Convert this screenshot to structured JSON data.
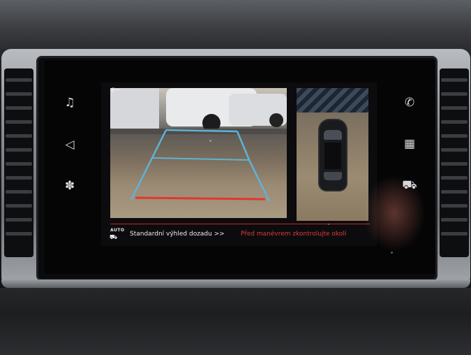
{
  "sidebar_left": {
    "items": [
      {
        "icon": "music-note-icon",
        "glyph": "♫"
      },
      {
        "icon": "navigation-icon",
        "glyph": "◁"
      },
      {
        "icon": "fan-icon",
        "glyph": "✽"
      }
    ]
  },
  "sidebar_right": {
    "items": [
      {
        "icon": "phone-icon",
        "glyph": "✆"
      },
      {
        "icon": "apps-grid-icon",
        "glyph": "▦"
      },
      {
        "icon": "car-icon",
        "glyph": "⛟"
      }
    ]
  },
  "camera": {
    "back_icon": "←",
    "guide_colors": {
      "lines": "#5fb3d6",
      "red_line": "#e2372f"
    }
  },
  "status_bar": {
    "auto_label": "AUTO",
    "auto_car_icon": "⛟",
    "view_text": "Standardní výhled dozadu >>",
    "warning_text": "Před manévrem zkontrolujte okolí",
    "warning_color": "#e03a3f",
    "divider_color": "#c2262b"
  }
}
